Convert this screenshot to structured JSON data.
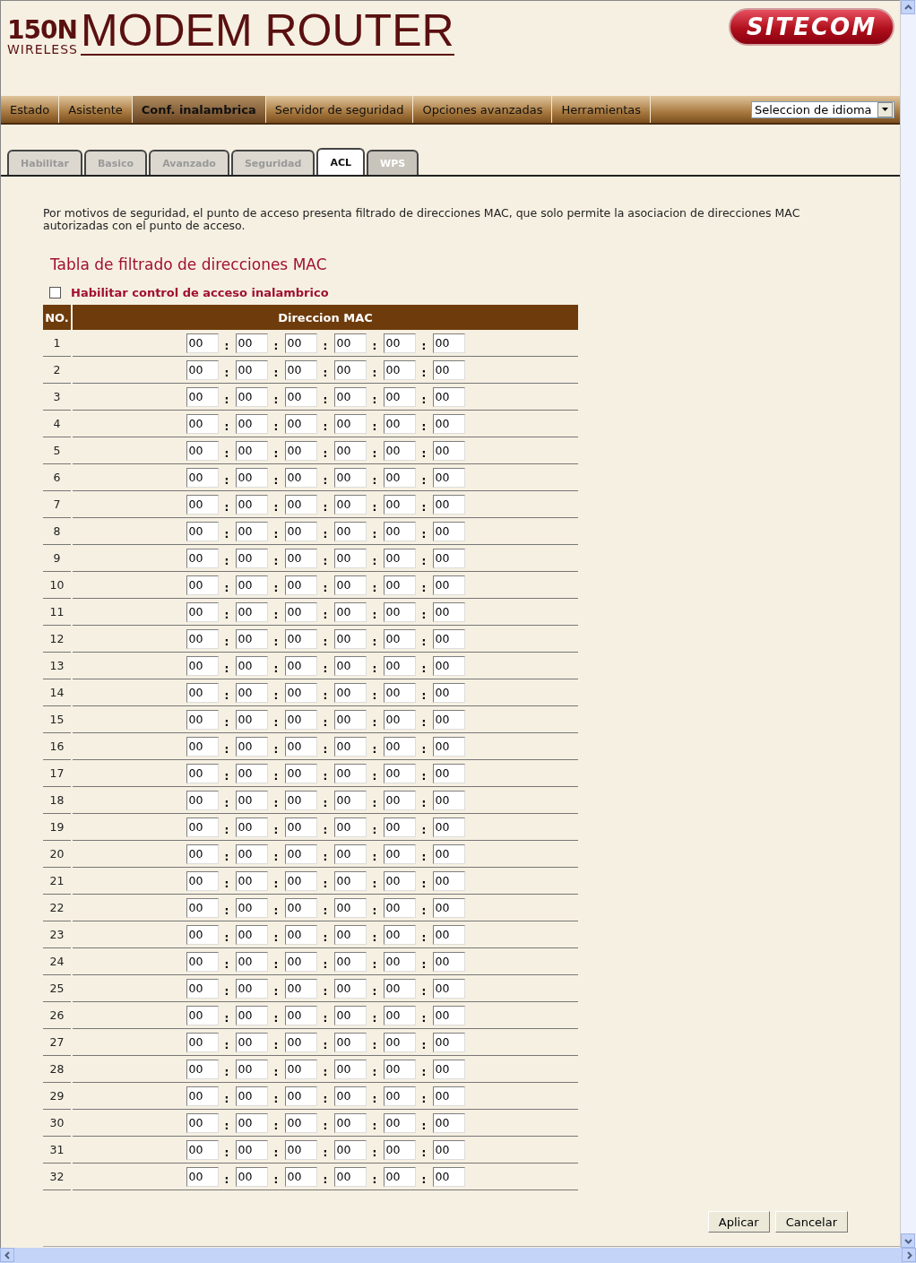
{
  "header": {
    "model": "150N",
    "model_sub": "WIRELESS",
    "product": "MODEM ROUTER",
    "brand": "SITECOM"
  },
  "nav": [
    {
      "label": "Estado",
      "selected": false
    },
    {
      "label": "Asistente",
      "selected": false
    },
    {
      "label": "Conf. inalambrica",
      "selected": true
    },
    {
      "label": "Servidor de seguridad",
      "selected": false
    },
    {
      "label": "Opciones avanzadas",
      "selected": false
    },
    {
      "label": "Herramientas",
      "selected": false
    }
  ],
  "language_select": {
    "value": "Seleccion de idioma"
  },
  "subtabs": [
    {
      "label": "Habilitar",
      "selected": false,
      "kind": "normal"
    },
    {
      "label": "Basico",
      "selected": false,
      "kind": "normal"
    },
    {
      "label": "Avanzado",
      "selected": false,
      "kind": "normal"
    },
    {
      "label": "Seguridad",
      "selected": false,
      "kind": "normal"
    },
    {
      "label": "ACL",
      "selected": true,
      "kind": "normal"
    },
    {
      "label": "WPS",
      "selected": false,
      "kind": "alt"
    }
  ],
  "description": "Por motivos de seguridad, el punto de acceso presenta filtrado de direcciones MAC, que solo permite la asociacion de direcciones MAC autorizadas con el punto de acceso.",
  "section_title": "Tabla de filtrado de direcciones MAC",
  "enable_acl": {
    "label": "Habilitar control de acceso inalambrico",
    "checked": false
  },
  "table": {
    "columns": [
      "NO.",
      "Direccion MAC"
    ],
    "separator": ":",
    "rows": [
      {
        "no": "1",
        "mac": [
          "00",
          "00",
          "00",
          "00",
          "00",
          "00"
        ]
      },
      {
        "no": "2",
        "mac": [
          "00",
          "00",
          "00",
          "00",
          "00",
          "00"
        ]
      },
      {
        "no": "3",
        "mac": [
          "00",
          "00",
          "00",
          "00",
          "00",
          "00"
        ]
      },
      {
        "no": "4",
        "mac": [
          "00",
          "00",
          "00",
          "00",
          "00",
          "00"
        ]
      },
      {
        "no": "5",
        "mac": [
          "00",
          "00",
          "00",
          "00",
          "00",
          "00"
        ]
      },
      {
        "no": "6",
        "mac": [
          "00",
          "00",
          "00",
          "00",
          "00",
          "00"
        ]
      },
      {
        "no": "7",
        "mac": [
          "00",
          "00",
          "00",
          "00",
          "00",
          "00"
        ]
      },
      {
        "no": "8",
        "mac": [
          "00",
          "00",
          "00",
          "00",
          "00",
          "00"
        ]
      },
      {
        "no": "9",
        "mac": [
          "00",
          "00",
          "00",
          "00",
          "00",
          "00"
        ]
      },
      {
        "no": "10",
        "mac": [
          "00",
          "00",
          "00",
          "00",
          "00",
          "00"
        ]
      },
      {
        "no": "11",
        "mac": [
          "00",
          "00",
          "00",
          "00",
          "00",
          "00"
        ]
      },
      {
        "no": "12",
        "mac": [
          "00",
          "00",
          "00",
          "00",
          "00",
          "00"
        ]
      },
      {
        "no": "13",
        "mac": [
          "00",
          "00",
          "00",
          "00",
          "00",
          "00"
        ]
      },
      {
        "no": "14",
        "mac": [
          "00",
          "00",
          "00",
          "00",
          "00",
          "00"
        ]
      },
      {
        "no": "15",
        "mac": [
          "00",
          "00",
          "00",
          "00",
          "00",
          "00"
        ]
      },
      {
        "no": "16",
        "mac": [
          "00",
          "00",
          "00",
          "00",
          "00",
          "00"
        ]
      },
      {
        "no": "17",
        "mac": [
          "00",
          "00",
          "00",
          "00",
          "00",
          "00"
        ]
      },
      {
        "no": "18",
        "mac": [
          "00",
          "00",
          "00",
          "00",
          "00",
          "00"
        ]
      },
      {
        "no": "19",
        "mac": [
          "00",
          "00",
          "00",
          "00",
          "00",
          "00"
        ]
      },
      {
        "no": "20",
        "mac": [
          "00",
          "00",
          "00",
          "00",
          "00",
          "00"
        ]
      },
      {
        "no": "21",
        "mac": [
          "00",
          "00",
          "00",
          "00",
          "00",
          "00"
        ]
      },
      {
        "no": "22",
        "mac": [
          "00",
          "00",
          "00",
          "00",
          "00",
          "00"
        ]
      },
      {
        "no": "23",
        "mac": [
          "00",
          "00",
          "00",
          "00",
          "00",
          "00"
        ]
      },
      {
        "no": "24",
        "mac": [
          "00",
          "00",
          "00",
          "00",
          "00",
          "00"
        ]
      },
      {
        "no": "25",
        "mac": [
          "00",
          "00",
          "00",
          "00",
          "00",
          "00"
        ]
      },
      {
        "no": "26",
        "mac": [
          "00",
          "00",
          "00",
          "00",
          "00",
          "00"
        ]
      },
      {
        "no": "27",
        "mac": [
          "00",
          "00",
          "00",
          "00",
          "00",
          "00"
        ]
      },
      {
        "no": "28",
        "mac": [
          "00",
          "00",
          "00",
          "00",
          "00",
          "00"
        ]
      },
      {
        "no": "29",
        "mac": [
          "00",
          "00",
          "00",
          "00",
          "00",
          "00"
        ]
      },
      {
        "no": "30",
        "mac": [
          "00",
          "00",
          "00",
          "00",
          "00",
          "00"
        ]
      },
      {
        "no": "31",
        "mac": [
          "00",
          "00",
          "00",
          "00",
          "00",
          "00"
        ]
      },
      {
        "no": "32",
        "mac": [
          "00",
          "00",
          "00",
          "00",
          "00",
          "00"
        ]
      }
    ]
  },
  "buttons": [
    "Aplicar",
    "Cancelar"
  ]
}
